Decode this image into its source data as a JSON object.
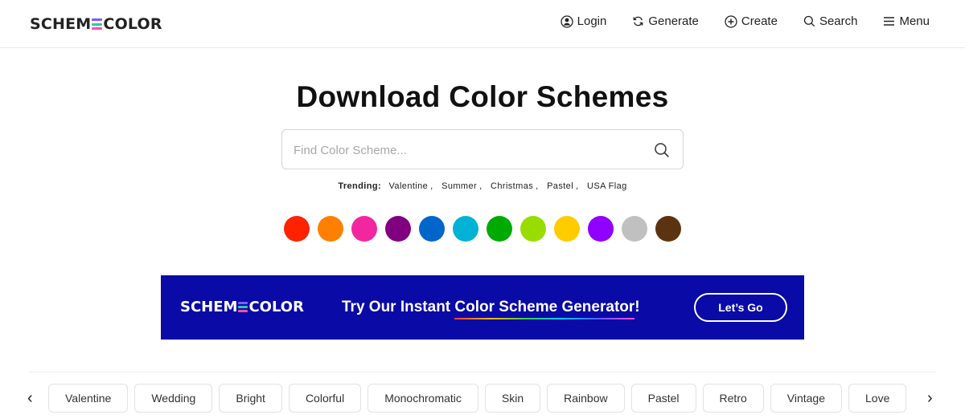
{
  "brand": {
    "logo_left": "SCHEM",
    "logo_right": "COLOR",
    "logo_mark_colors": [
      "#7b5cff",
      "#2ec4b6",
      "#ff4fa3"
    ]
  },
  "nav": {
    "items": [
      {
        "label": "Login",
        "icon": "user-icon"
      },
      {
        "label": "Generate",
        "icon": "refresh-icon"
      },
      {
        "label": "Create",
        "icon": "plus-circle-icon"
      },
      {
        "label": "Search",
        "icon": "search-icon"
      },
      {
        "label": "Menu",
        "icon": "hamburger-icon"
      }
    ]
  },
  "hero": {
    "title": "Download Color Schemes",
    "search_placeholder": "Find Color Scheme...",
    "search_value": ""
  },
  "trending": {
    "label": "Trending:",
    "items": [
      "Valentine",
      "Summer",
      "Christmas",
      "Pastel",
      "USA Flag"
    ]
  },
  "swatches": [
    "#ff2200",
    "#ff8000",
    "#f227a0",
    "#800080",
    "#0066cc",
    "#00b2d6",
    "#00aa00",
    "#99dd00",
    "#ffcc00",
    "#8f00ff",
    "#c0c0c0",
    "#5c3310"
  ],
  "banner": {
    "logo_left": "SCHEM",
    "logo_right": "COLOR",
    "pitch_prefix": "Try Our Instant ",
    "pitch_highlight": "Color Scheme Generator",
    "pitch_suffix": "!",
    "cta": "Let’s Go",
    "background": "#0a0aa6"
  },
  "categories": {
    "prev_glyph": "‹",
    "next_glyph": "›",
    "items": [
      "Valentine",
      "Wedding",
      "Bright",
      "Colorful",
      "Monochromatic",
      "Skin",
      "Rainbow",
      "Pastel",
      "Retro",
      "Vintage",
      "Love"
    ]
  }
}
